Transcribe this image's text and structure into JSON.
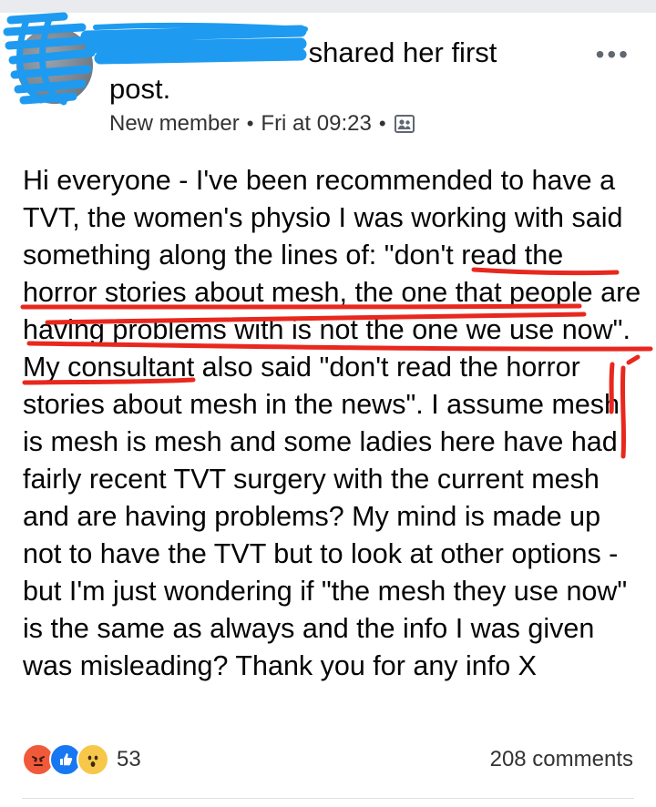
{
  "post": {
    "author_suffix": "shared her first post.",
    "badge": "New member",
    "separator": "•",
    "time": "Fri at 09:23",
    "separator2": "•",
    "more": "•••",
    "body": "Hi everyone - I've been recommended to have a TVT, the women's physio I was working with said something along the lines of: \"don't read the horror stories about mesh, the one that people are having problems with is not the one we use now\". My consultant also said \"don't read the horror stories about mesh in the news\". I assume mesh is mesh is mesh and some ladies here have had fairly recent TVT surgery with the current mesh and are having problems? My mind is made up not to have the TVT but to look at other options - but I'm just wondering if \"the mesh they use now\" is the same as always and the info I was given was misleading? Thank you for any info X"
  },
  "footer": {
    "reaction_icons": [
      "angry-icon",
      "like-icon",
      "wow-icon"
    ],
    "reaction_count": "53",
    "comments": "208 comments"
  },
  "colors": {
    "annotation_blue": "#1e9bf0",
    "annotation_red": "#e8281e",
    "like_blue": "#1877f2",
    "angry_orange": "#f0593a",
    "wow_yellow": "#f7c74a"
  }
}
